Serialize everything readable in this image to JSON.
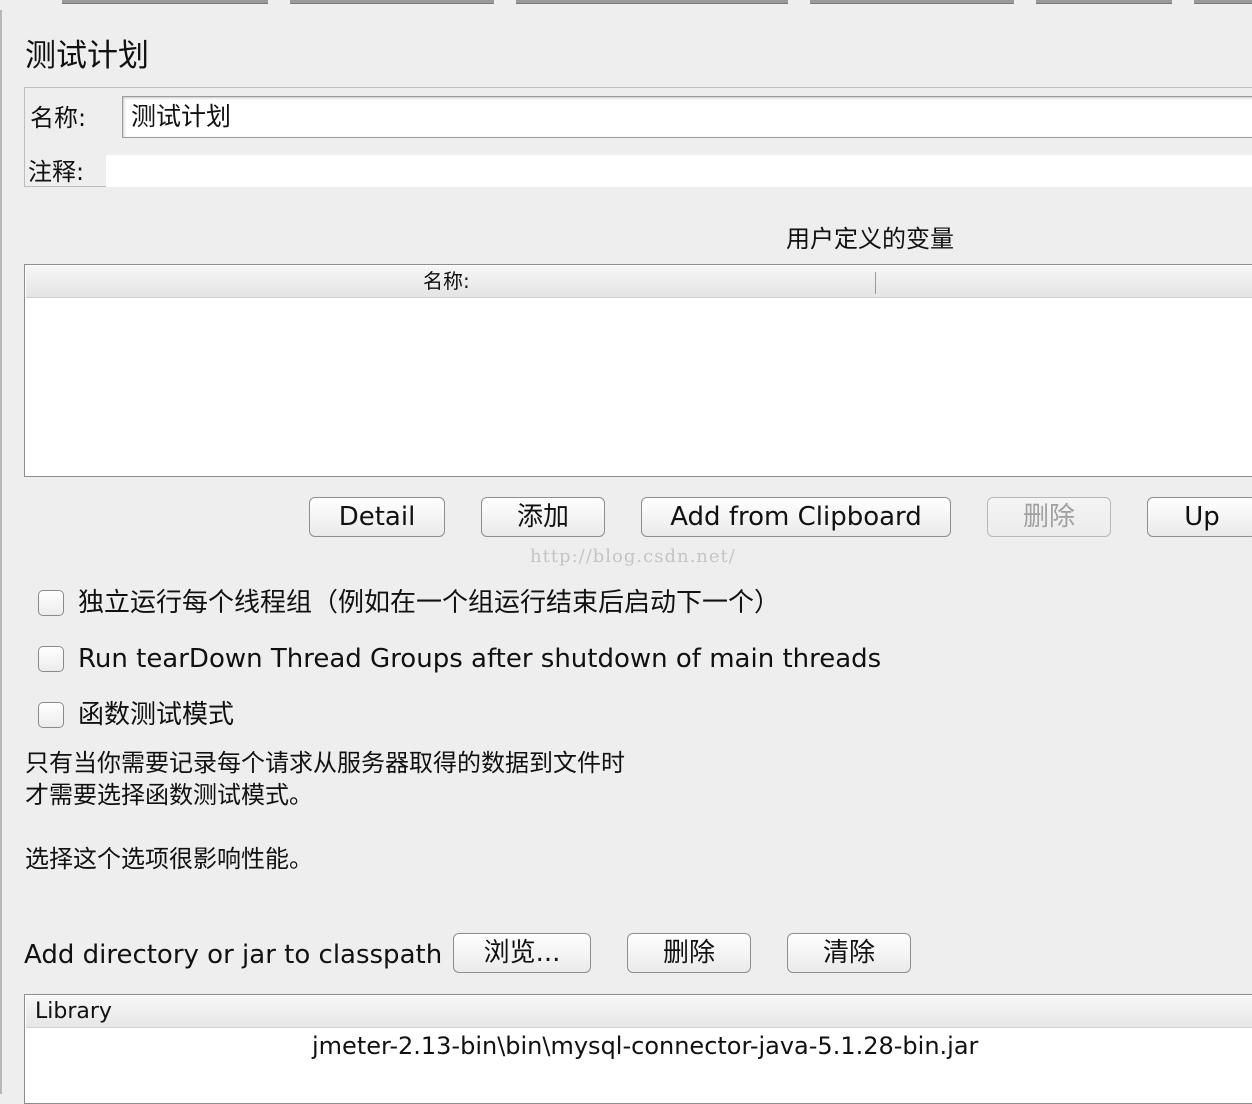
{
  "panel": {
    "title": "测试计划",
    "name_label": "名称:",
    "name_value": "测试计划",
    "comment_label": "注释:",
    "comment_value": ""
  },
  "variables": {
    "section_title": "用户定义的变量",
    "columns": [
      "名称:",
      ""
    ],
    "rows": []
  },
  "variable_buttons": {
    "detail": "Detail",
    "add": "添加",
    "add_from_clipboard": "Add from Clipboard",
    "delete": "删除",
    "up": "Up"
  },
  "watermark": "http://blog.csdn.net/",
  "options": {
    "independent_thread_groups": {
      "label": "独立运行每个线程组（例如在一个组运行结束后启动下一个）",
      "checked": false
    },
    "teardown_after_shutdown": {
      "label": "Run tearDown Thread Groups after shutdown of main threads",
      "checked": false
    },
    "functional_mode": {
      "label": "函数测试模式",
      "checked": false
    }
  },
  "notes": {
    "line1": "只有当你需要记录每个请求从服务器取得的数据到文件时",
    "line2": "才需要选择函数测试模式。",
    "line3": "选择这个选项很影响性能。"
  },
  "classpath": {
    "label": "Add directory or jar to classpath",
    "browse_button": "浏览...",
    "delete_button": "删除",
    "clear_button": "清除",
    "table_header": "Library",
    "rows": [
      "jmeter-2.13-bin\\bin\\mysql-connector-java-5.1.28-bin.jar"
    ]
  }
}
